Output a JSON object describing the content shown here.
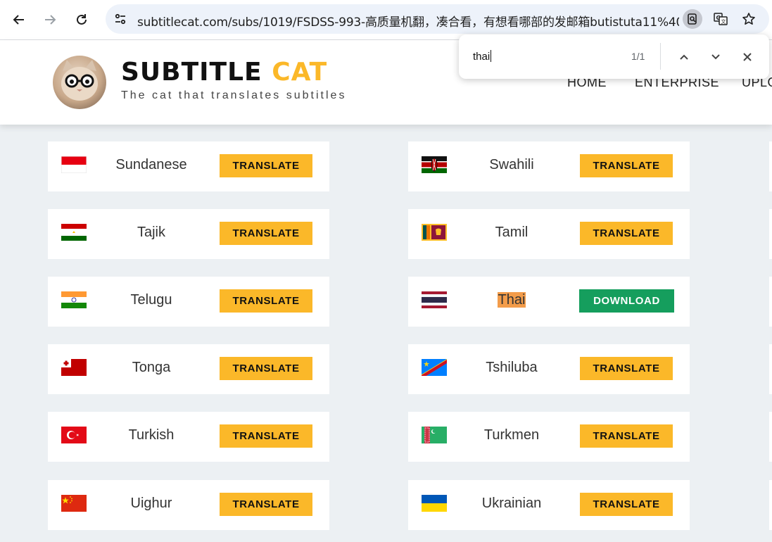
{
  "browser": {
    "url": "subtitlecat.com/subs/1019/FSDSS-993-高质量机翻，凑合看，有想看哪部的发邮箱butistuta11%40..."
  },
  "site": {
    "brand_part1": "SUBTITLE",
    "brand_part2": "CAT",
    "tagline": "The cat that translates subtitles",
    "nav": [
      "HOME",
      "ENTERPRISE",
      "UPLO"
    ]
  },
  "findbar": {
    "query": "thai",
    "count": "1/1"
  },
  "colors": {
    "translate_button": "#fbb829",
    "download_button": "#159e5d",
    "find_highlight": "#f39c4a",
    "background": "#ecf0f3"
  },
  "languages": [
    {
      "name": "Sundanese",
      "flag": "indonesia-flag",
      "action": "TRANSLATE"
    },
    {
      "name": "Swahili",
      "flag": "kenya-flag",
      "action": "TRANSLATE"
    },
    {
      "name": "Tajik",
      "flag": "tajikistan-flag",
      "action": "TRANSLATE"
    },
    {
      "name": "Tamil",
      "flag": "sri-lanka-flag",
      "action": "TRANSLATE"
    },
    {
      "name": "Telugu",
      "flag": "india-flag",
      "action": "TRANSLATE"
    },
    {
      "name": "Thai",
      "flag": "thailand-flag",
      "action": "DOWNLOAD"
    },
    {
      "name": "Tonga",
      "flag": "tonga-flag",
      "action": "TRANSLATE"
    },
    {
      "name": "Tshiluba",
      "flag": "congo-dr-flag",
      "action": "TRANSLATE"
    },
    {
      "name": "Turkish",
      "flag": "turkey-flag",
      "action": "TRANSLATE"
    },
    {
      "name": "Turkmen",
      "flag": "turkmenistan-flag",
      "action": "TRANSLATE"
    },
    {
      "name": "Uighur",
      "flag": "china-flag",
      "action": "TRANSLATE"
    },
    {
      "name": "Ukrainian",
      "flag": "ukraine-flag",
      "action": "TRANSLATE"
    }
  ]
}
